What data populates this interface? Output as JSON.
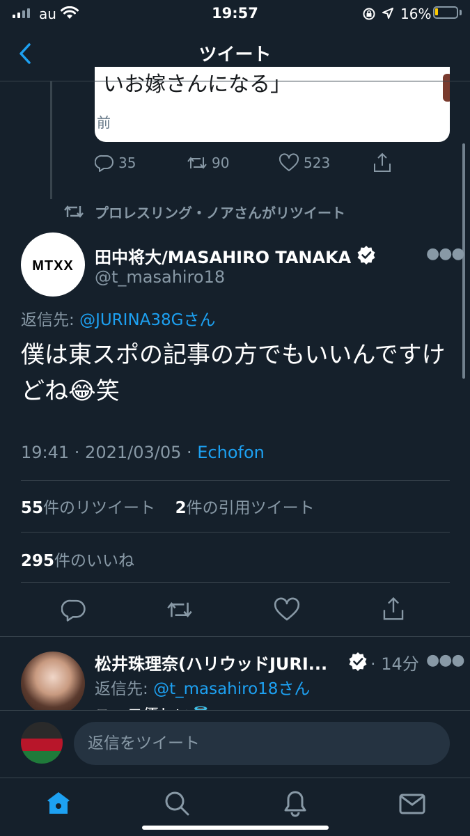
{
  "status_bar": {
    "carrier": "au",
    "time": "19:57",
    "battery_percent": "16%",
    "battery_level": 0.16
  },
  "header": {
    "title": "ツイート"
  },
  "previous_tweet": {
    "quote_text": "いお嫁さんになる」",
    "quote_sub": "前",
    "replies": "35",
    "retweets": "90",
    "likes": "523"
  },
  "retweeted_by": "プロレスリング・ノアさんがリツイート",
  "main_tweet": {
    "avatar_text": "MTXX",
    "name": "田中将大/MASAHIRO TANAKA",
    "handle": "@t_masahiro18",
    "reply_prefix": "返信先: ",
    "reply_to": "@JURINA38Gさん",
    "text": "僕は東スポの記事の方でもいいんですけどね😂笑",
    "time": "19:41 · 2021/03/05 · ",
    "source": "Echofon",
    "retweet_count": "55",
    "retweet_label": "件のリツイート",
    "quote_count": "2",
    "quote_label": "件の引用ツイート",
    "like_count": "295",
    "like_label": "件のいいね"
  },
  "reply_tweet": {
    "name": "松井珠理奈(ハリウッドJURI...",
    "time": "· 14分",
    "reply_prefix": "返信先: ",
    "reply_to": "@t_masahiro18さん",
    "text_peek": "ユーモ優しい👼"
  },
  "compose": {
    "placeholder": "返信をツイート"
  },
  "colors": {
    "background": "#15202b",
    "accent": "#1da1f2",
    "muted": "#8899a6",
    "divider": "#38444d"
  }
}
